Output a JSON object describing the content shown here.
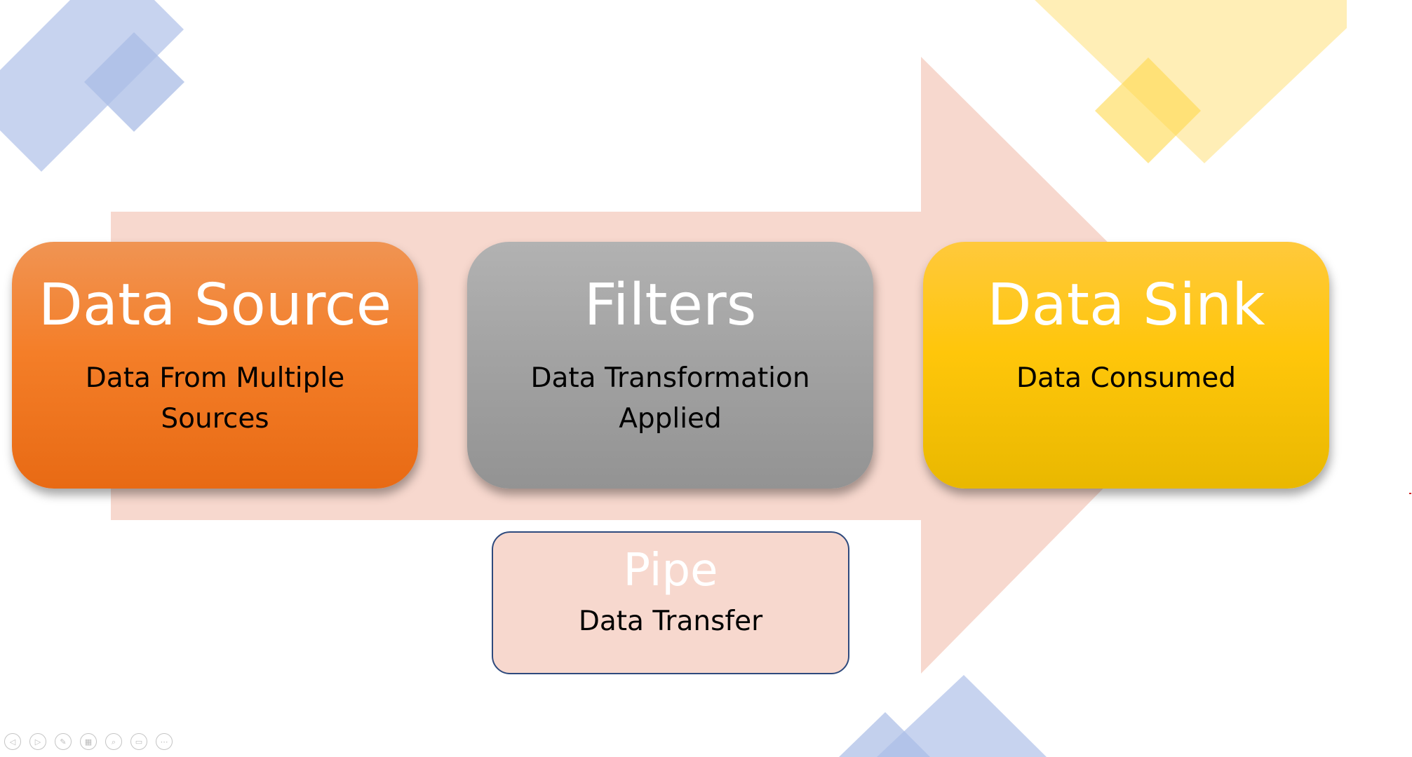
{
  "slide": {
    "colors": {
      "arrow": "#f7d8ce",
      "blue_diamond": "#a9bce6",
      "yellow_diamond": "#ffe07a",
      "source_box": "#f47e28",
      "filters_box": "#a3a3a3",
      "sink_box": "#ffc60a",
      "pipe_border": "#2e4a7d"
    },
    "data_source": {
      "title": "Data Source",
      "description": "Data From Multiple Sources"
    },
    "filters": {
      "title": "Filters",
      "description": "Data Transformation Applied"
    },
    "data_sink": {
      "title": "Data Sink",
      "description": "Data Consumed"
    },
    "pipe": {
      "title": "Pipe",
      "description": "Data Transfer"
    }
  },
  "slideshow_controls": [
    {
      "name": "previous-slide-icon",
      "glyph": "◁"
    },
    {
      "name": "next-slide-icon",
      "glyph": "▷"
    },
    {
      "name": "pen-icon",
      "glyph": "✎"
    },
    {
      "name": "see-all-slides-icon",
      "glyph": "▦"
    },
    {
      "name": "zoom-icon",
      "glyph": "⌕"
    },
    {
      "name": "subtitles-icon",
      "glyph": "▭"
    },
    {
      "name": "more-options-icon",
      "glyph": "⋯"
    }
  ]
}
